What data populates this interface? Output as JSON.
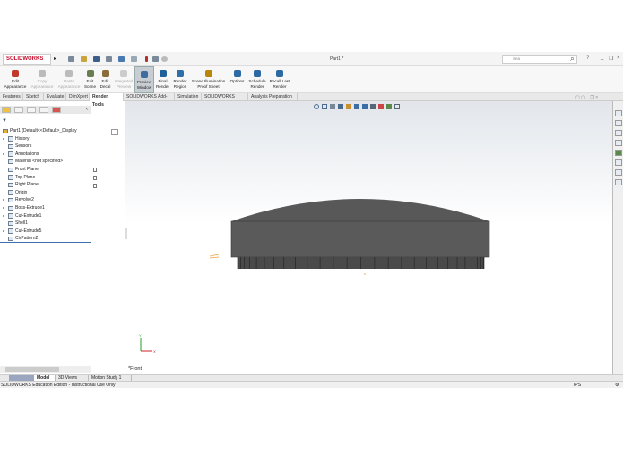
{
  "app": {
    "brand": "SOLIDWORKS",
    "document_title": "Part1 *",
    "search_placeholder": "Sea"
  },
  "ribbon": [
    {
      "label": "Edit Appearance",
      "enabled": true,
      "color": "#c0392b"
    },
    {
      "label": "Copy Appearance",
      "enabled": false,
      "color": "#bbb"
    },
    {
      "label": "Paste Appearance",
      "enabled": false,
      "color": "#bbb"
    },
    {
      "label": "Edit Scene",
      "enabled": true,
      "color": "#6a7d4f"
    },
    {
      "label": "Edit Decal",
      "enabled": true,
      "color": "#8a6d3b"
    },
    {
      "label": "Integrated Preview",
      "enabled": false,
      "color": "#ccc"
    },
    {
      "label": "Preview Window",
      "enabled": true,
      "selected": true,
      "color": "#3d6c9e"
    },
    {
      "label": "Final Render",
      "enabled": true,
      "color": "#1f5f9a"
    },
    {
      "label": "Render Region",
      "enabled": true,
      "color": "#2f6fa8"
    },
    {
      "label": "Scene Illumination Proof Sheet",
      "enabled": true,
      "color": "#b8860b"
    },
    {
      "label": "Options",
      "enabled": true,
      "color": "#2d6aa3"
    },
    {
      "label": "Schedule Render",
      "enabled": true,
      "color": "#2d6aa3"
    },
    {
      "label": "Recall Last Render",
      "enabled": true,
      "color": "#2d6aa3"
    }
  ],
  "tabs": [
    "Features",
    "Sketch",
    "Evaluate",
    "DimXpert",
    "Render Tools",
    "SOLIDWORKS Add-Ins",
    "Simulation",
    "SOLIDWORKS MBD",
    "Analysis Preparation"
  ],
  "active_tab": "Render Tools",
  "tree": {
    "root": "Part1  (Default<<Default>_Display",
    "items": [
      {
        "label": "History",
        "expandable": true
      },
      {
        "label": "Sensors",
        "expandable": false
      },
      {
        "label": "Annotations",
        "expandable": true
      },
      {
        "label": "Material <not specified>",
        "expandable": false
      },
      {
        "label": "Front Plane",
        "expandable": false
      },
      {
        "label": "Top Plane",
        "expandable": false
      },
      {
        "label": "Right Plane",
        "expandable": false
      },
      {
        "label": "Origin",
        "expandable": false
      },
      {
        "label": "Revolve2",
        "expandable": true
      },
      {
        "label": "Boss-Extrude1",
        "expandable": true
      },
      {
        "label": "Cut-Extrude1",
        "expandable": true
      },
      {
        "label": "Shell1",
        "expandable": false
      },
      {
        "label": "Cut-Extrude5",
        "expandable": true
      },
      {
        "label": "CirPattern2",
        "expandable": false
      }
    ]
  },
  "viewport": {
    "view_label": "*Front",
    "model_color": "#5a5a5a"
  },
  "bottom_tabs": [
    "Model",
    "3D Views",
    "Motion Study 1"
  ],
  "active_bottom_tab": "Model",
  "status": {
    "text": "SOLIDWORKS Education Edition - Instructional Use Only",
    "units": "IPS"
  }
}
